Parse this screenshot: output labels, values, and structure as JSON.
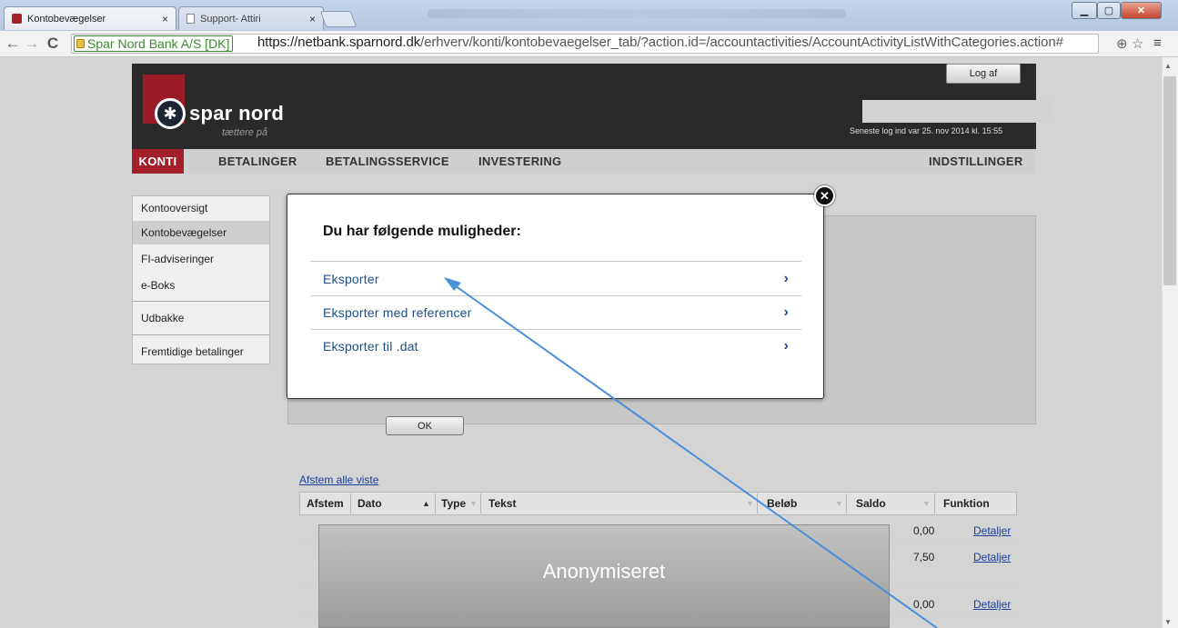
{
  "browser": {
    "tabs": [
      {
        "title": "Kontobevægelser",
        "close": "×"
      },
      {
        "title": "Support- Attiri",
        "close": "×"
      }
    ],
    "nav": {
      "back": "←",
      "forward": "→",
      "reload": "C"
    },
    "secure_label": "Spar Nord Bank A/S [DK]",
    "url_scheme": "https://",
    "url_host": "netbank.sparnord.dk",
    "url_path": "/erhverv/konti/kontobevaegelser_tab/?action.id=/accountactivities/AccountActivityListWithCategories.action#",
    "window_buttons": {
      "minimize": "▁",
      "maximize": "▢",
      "close": "✕"
    }
  },
  "header": {
    "logo_main": "spar nord",
    "logo_tagline": "tættere på",
    "logoff": "Log af",
    "last_login": "Seneste log ind var 25. nov 2014 kl. 15:55"
  },
  "nav": [
    "KONTI",
    "BETALINGER",
    "BETALINGSSERVICE",
    "INVESTERING",
    "INDSTILLINGER"
  ],
  "sidebar": [
    {
      "label": "Kontooversigt"
    },
    {
      "label": "Kontobevægelser"
    },
    {
      "label": "FI-adviseringer"
    },
    {
      "label": "e-Boks"
    },
    {
      "label": "Udbakke"
    },
    {
      "label": "Fremtidige betalinger"
    }
  ],
  "modal": {
    "title": "Du har følgende muligheder:",
    "options": [
      {
        "label": "Eksporter",
        "chevron": "›"
      },
      {
        "label": "Eksporter med referencer",
        "chevron": "›"
      },
      {
        "label": "Eksporter til .dat",
        "chevron": "›"
      }
    ],
    "close": "✕"
  },
  "ok_button": "OK",
  "afstem_link": "Afstem alle viste",
  "table": {
    "headers": [
      "Afstem",
      "Dato",
      "Type",
      "Tekst",
      "Beløb",
      "Saldo",
      "Funktion"
    ],
    "rows": [
      {
        "saldo": "0,00",
        "action": "Detaljer"
      },
      {
        "saldo": "7,50",
        "action": "Detaljer"
      },
      {
        "saldo": "0,00",
        "action": "Detaljer"
      }
    ]
  },
  "anonymized_label": "Anonymiseret",
  "colors": {
    "brand_red": "#a31f2a",
    "link_blue": "#1d4e86",
    "arrow": "#4a90d9"
  }
}
